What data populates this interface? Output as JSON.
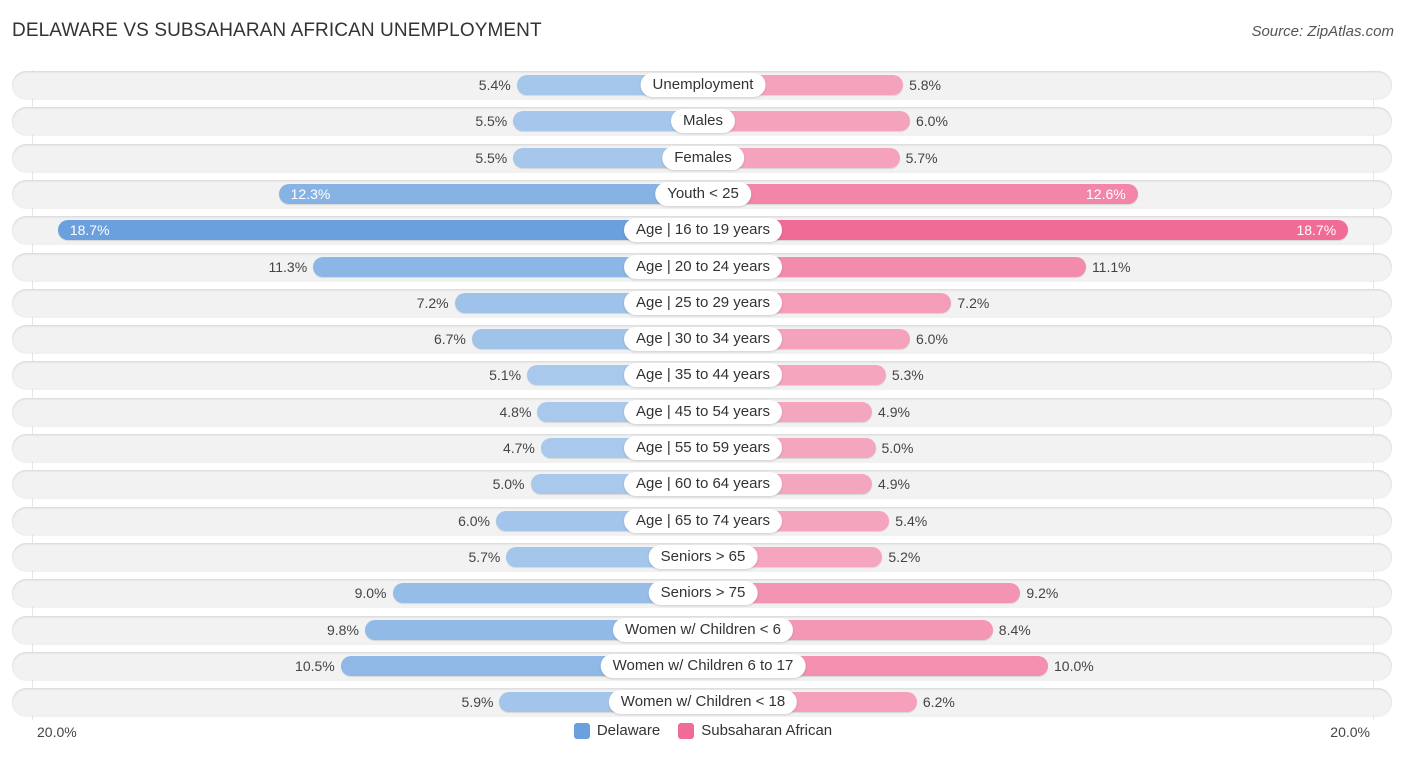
{
  "header": {
    "title": "DELAWARE VS SUBSAHARAN AFRICAN UNEMPLOYMENT",
    "source": "Source: ZipAtlas.com"
  },
  "colors": {
    "delaware": "#6aa0dd",
    "delaware_light": "#a8c8ec",
    "subsaharan": "#f06b95",
    "subsaharan_light": "#f5a6bf"
  },
  "legend": {
    "items": [
      {
        "label": "Delaware",
        "color": "#6aa0dd"
      },
      {
        "label": "Subsaharan African",
        "color": "#f06b95"
      }
    ]
  },
  "axis": {
    "left_label": "20.0%",
    "right_label": "20.0%"
  },
  "chart_data": {
    "type": "bar",
    "orientation": "horizontal-diverging",
    "title": "DELAWARE VS SUBSAHARAN AFRICAN UNEMPLOYMENT",
    "xlabel": "",
    "ylabel": "",
    "xlim": [
      -20,
      20
    ],
    "grid": false,
    "legend_position": "bottom",
    "categories": [
      "Unemployment",
      "Males",
      "Females",
      "Youth < 25",
      "Age | 16 to 19 years",
      "Age | 20 to 24 years",
      "Age | 25 to 29 years",
      "Age | 30 to 34 years",
      "Age | 35 to 44 years",
      "Age | 45 to 54 years",
      "Age | 55 to 59 years",
      "Age | 60 to 64 years",
      "Age | 65 to 74 years",
      "Seniors > 65",
      "Seniors > 75",
      "Women w/ Children < 6",
      "Women w/ Children 6 to 17",
      "Women w/ Children < 18"
    ],
    "series": [
      {
        "name": "Delaware",
        "side": "left",
        "values": [
          5.4,
          5.5,
          5.5,
          12.3,
          18.7,
          11.3,
          7.2,
          6.7,
          5.1,
          4.8,
          4.7,
          5.0,
          6.0,
          5.7,
          9.0,
          9.8,
          10.5,
          5.9
        ],
        "labels": [
          "5.4%",
          "5.5%",
          "5.5%",
          "12.3%",
          "18.7%",
          "11.3%",
          "7.2%",
          "6.7%",
          "5.1%",
          "4.8%",
          "4.7%",
          "5.0%",
          "6.0%",
          "5.7%",
          "9.0%",
          "9.8%",
          "10.5%",
          "5.9%"
        ]
      },
      {
        "name": "Subsaharan African",
        "side": "right",
        "values": [
          5.8,
          6.0,
          5.7,
          12.6,
          18.7,
          11.1,
          7.2,
          6.0,
          5.3,
          4.9,
          5.0,
          4.9,
          5.4,
          5.2,
          9.2,
          8.4,
          10.0,
          6.2
        ],
        "labels": [
          "5.8%",
          "6.0%",
          "5.7%",
          "12.6%",
          "18.7%",
          "11.1%",
          "7.2%",
          "6.0%",
          "5.3%",
          "4.9%",
          "5.0%",
          "4.9%",
          "5.4%",
          "5.2%",
          "9.2%",
          "8.4%",
          "10.0%",
          "6.2%"
        ]
      }
    ]
  }
}
